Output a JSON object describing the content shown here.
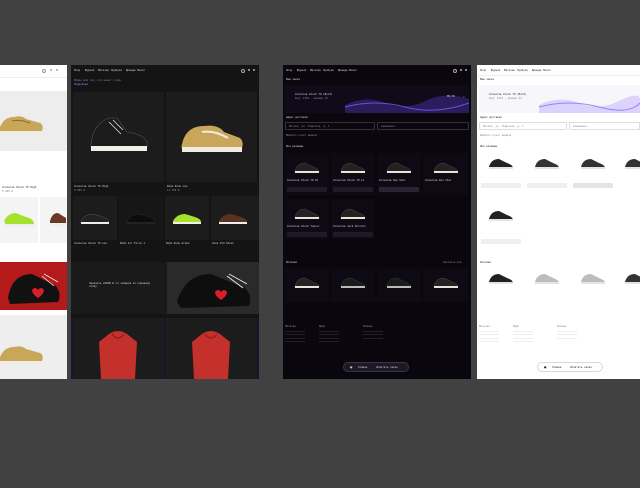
{
  "nav": {
    "items": [
      "Shop",
      "Журнал",
      "Магазин",
      "Лукбуки",
      "Бренды",
      "Поиск"
    ]
  },
  "p2": {
    "headline": "Обувь для тех, кто ценит стиль",
    "promo": "Заказать ≥5000 ₽ со скидкой по кодовому слову",
    "cta": "Подробнее",
    "products": [
      {
        "name": "Converse Chuck 70 High",
        "price": "8 990 ₽"
      },
      {
        "name": "Nike Dunk Low",
        "price": "12 490 ₽"
      },
      {
        "name": "Converse Chuck 70 Low",
        "price": "7 990 ₽"
      },
      {
        "name": "Nike Air Force 1",
        "price": "10 990 ₽"
      },
      {
        "name": "Nike Dunk Green",
        "price": "11 490 ₽"
      },
      {
        "name": "Vans Old Skool",
        "price": "6 990 ₽"
      }
    ]
  },
  "p3": {
    "section_title": "Ваш заказ",
    "order_name": "Converse Chuck 70 (Bold)",
    "order_sub": "Код: 1234 · размер 42",
    "order_price": "89,50",
    "delivery_title": "Адрес доставки",
    "delivery_city": "Москва, ул. Тверская, д. 1",
    "delivery_street": "Самовывоз",
    "pickup_label": "Выбрать пункт выдачи",
    "grid_title": "Мои размеры",
    "grid_items": [
      {
        "name": "Converse Chuck 70 Hi"
      },
      {
        "name": "Converse Chuck 70 Lo"
      },
      {
        "name": "Converse One Star"
      },
      {
        "name": "Converse Run Star"
      },
      {
        "name": "Converse Chuck Taylor"
      },
      {
        "name": "Converse Jack Purcell"
      }
    ],
    "similar_title": "Похожие",
    "similar_link": "Смотреть все",
    "footer_cols": [
      "Магазин",
      "Инфо",
      "Помощь"
    ],
    "btn_left": "Отмена",
    "btn_right": "Оплатить заказ"
  },
  "p4": {
    "section_title": "Ваш заказ",
    "order_name": "Converse Chuck 70 (Bold)",
    "order_sub": "Код: 1234 · размер 42",
    "order_price": "89,50",
    "delivery_title": "Адрес доставки",
    "delivery_city": "Москва, ул. Тверская, д. 1",
    "delivery_street": "Самовывоз",
    "pickup_label": "Выбрать пункт выдачи",
    "grid_title": "Мои размеры",
    "similar_title": "Похожие",
    "footer_cols": [
      "Магазин",
      "Инфо",
      "Помощь"
    ],
    "btn_left": "Отмена",
    "btn_right": "Оплатить заказ"
  }
}
